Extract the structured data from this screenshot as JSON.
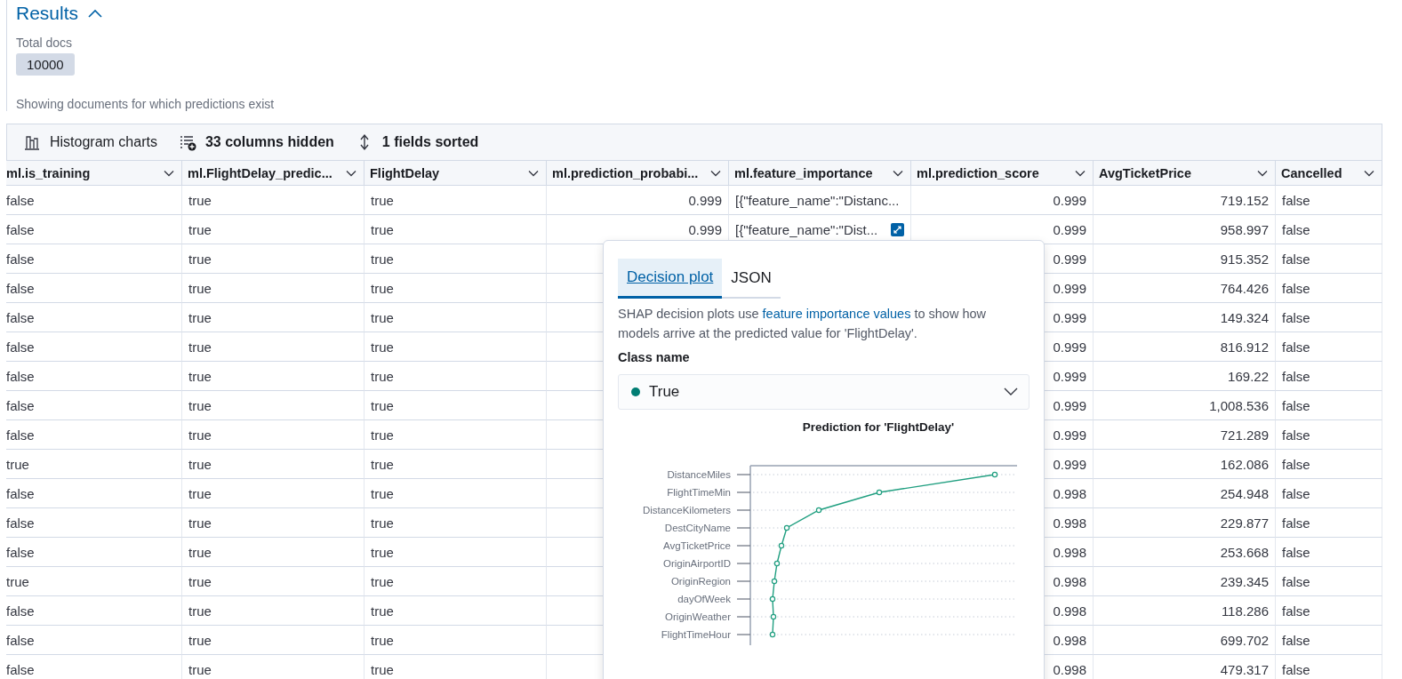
{
  "section": {
    "title": "Results",
    "expanded": true
  },
  "total_docs": {
    "label": "Total docs",
    "value": "10000"
  },
  "note": "Showing documents for which predictions exist",
  "toolbar": [
    {
      "kind": "histogram",
      "label": "Histogram charts",
      "active": false
    },
    {
      "kind": "columns",
      "label": "33 columns hidden",
      "active": true
    },
    {
      "kind": "sort",
      "label": "1 fields sorted",
      "active": true
    }
  ],
  "table": {
    "columns": [
      {
        "label": "ml.is_training"
      },
      {
        "label": "ml.FlightDelay_predic..."
      },
      {
        "label": "FlightDelay"
      },
      {
        "label": "ml.prediction_probabi..."
      },
      {
        "label": "ml.feature_importance"
      },
      {
        "label": "ml.prediction_score"
      },
      {
        "label": "AvgTicketPrice"
      },
      {
        "label": "Cancelled"
      }
    ],
    "rows": [
      {
        "is_training": "false",
        "prediction": "true",
        "flight_delay": "true",
        "probability": "0.999",
        "feature_importance": "[{\"feature_name\":\"Distanc...",
        "focused": false,
        "score": "0.999",
        "avg_ticket_price": "719.152",
        "cancelled": "false"
      },
      {
        "is_training": "false",
        "prediction": "true",
        "flight_delay": "true",
        "probability": "0.999",
        "feature_importance": "[{\"feature_name\":\"Dist...",
        "focused": true,
        "score": "0.999",
        "avg_ticket_price": "958.997",
        "cancelled": "false"
      },
      {
        "is_training": "false",
        "prediction": "true",
        "flight_delay": "true",
        "score": "0.999",
        "avg_ticket_price": "915.352",
        "cancelled": "false"
      },
      {
        "is_training": "false",
        "prediction": "true",
        "flight_delay": "true",
        "score": "0.999",
        "avg_ticket_price": "764.426",
        "cancelled": "false"
      },
      {
        "is_training": "false",
        "prediction": "true",
        "flight_delay": "true",
        "score": "0.999",
        "avg_ticket_price": "149.324",
        "cancelled": "false"
      },
      {
        "is_training": "false",
        "prediction": "true",
        "flight_delay": "true",
        "score": "0.999",
        "avg_ticket_price": "816.912",
        "cancelled": "false"
      },
      {
        "is_training": "false",
        "prediction": "true",
        "flight_delay": "true",
        "score": "0.999",
        "avg_ticket_price": "169.22",
        "cancelled": "false"
      },
      {
        "is_training": "false",
        "prediction": "true",
        "flight_delay": "true",
        "score": "0.999",
        "avg_ticket_price": "1,008.536",
        "cancelled": "false"
      },
      {
        "is_training": "false",
        "prediction": "true",
        "flight_delay": "true",
        "score": "0.999",
        "avg_ticket_price": "721.289",
        "cancelled": "false"
      },
      {
        "is_training": "true",
        "prediction": "true",
        "flight_delay": "true",
        "score": "0.999",
        "avg_ticket_price": "162.086",
        "cancelled": "false"
      },
      {
        "is_training": "false",
        "prediction": "true",
        "flight_delay": "true",
        "score": "0.998",
        "avg_ticket_price": "254.948",
        "cancelled": "false"
      },
      {
        "is_training": "false",
        "prediction": "true",
        "flight_delay": "true",
        "score": "0.998",
        "avg_ticket_price": "229.877",
        "cancelled": "false"
      },
      {
        "is_training": "false",
        "prediction": "true",
        "flight_delay": "true",
        "score": "0.998",
        "avg_ticket_price": "253.668",
        "cancelled": "false"
      },
      {
        "is_training": "true",
        "prediction": "true",
        "flight_delay": "true",
        "score": "0.998",
        "avg_ticket_price": "239.345",
        "cancelled": "false"
      },
      {
        "is_training": "false",
        "prediction": "true",
        "flight_delay": "true",
        "score": "0.998",
        "avg_ticket_price": "118.286",
        "cancelled": "false"
      },
      {
        "is_training": "false",
        "prediction": "true",
        "flight_delay": "true",
        "score": "0.998",
        "avg_ticket_price": "699.702",
        "cancelled": "false"
      },
      {
        "is_training": "false",
        "prediction": "true",
        "flight_delay": "true",
        "score": "0.998",
        "avg_ticket_price": "479.317",
        "cancelled": "false"
      }
    ]
  },
  "popover": {
    "tabs": [
      {
        "label": "Decision plot",
        "selected": true
      },
      {
        "label": "JSON",
        "selected": false
      }
    ],
    "description": {
      "before": "SHAP decision plots use ",
      "link": "feature importance values",
      "after": " to show how models arrive at the predicted value for 'FlightDelay'."
    },
    "class_label": "Class name",
    "class_select": {
      "value": "True",
      "color": "#017d73"
    },
    "plot": {
      "title": "Prediction for 'FlightDelay'",
      "features": [
        "DistanceMiles",
        "FlightTimeMin",
        "DistanceKilometers",
        "DestCityName",
        "AvgTicketPrice",
        "OriginAirportID",
        "OriginRegion",
        "dayOfWeek",
        "OriginWeather",
        "FlightTimeHour"
      ]
    }
  }
}
